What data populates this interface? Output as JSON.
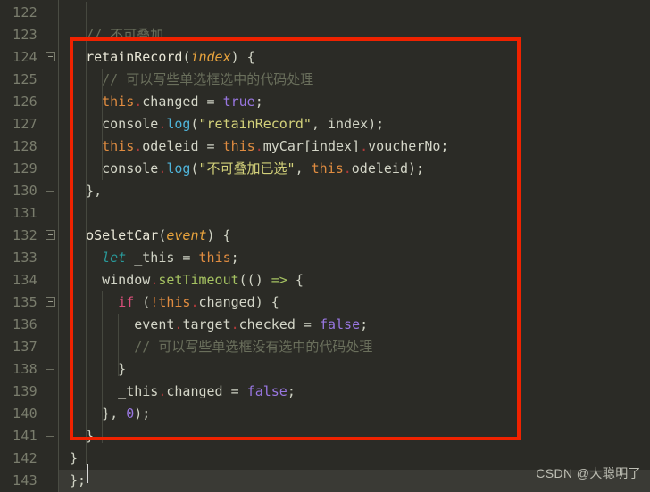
{
  "editor": {
    "background_color": "#2b2b26",
    "gutter_color": "#2b2b26",
    "line_number_color": "#7a7d6d",
    "current_line_color": "#3a3a35",
    "first_line_number": 122,
    "last_line_number": 143,
    "line_numbers": [
      "122",
      "123",
      "124",
      "125",
      "126",
      "127",
      "128",
      "129",
      "130",
      "131",
      "132",
      "133",
      "134",
      "135",
      "136",
      "137",
      "138",
      "139",
      "140",
      "141",
      "142",
      "143"
    ],
    "fold_lines": [
      "124",
      "132",
      "135"
    ],
    "dash_lines": [
      "130",
      "138",
      "141"
    ],
    "caret_line": "143"
  },
  "annotation": {
    "color": "#ef2200",
    "shape": "rectangle",
    "covers_lines_from": "124",
    "covers_lines_to": "141"
  },
  "watermark": {
    "text": "CSDN @大聪明了"
  },
  "code": {
    "lines": [
      {
        "n": "122",
        "text": ""
      },
      {
        "n": "123",
        "text": "  // 不可叠加"
      },
      {
        "n": "124",
        "text": "  retainRecord(index) {"
      },
      {
        "n": "125",
        "text": "    // 可以写些单选框选中的代码处理"
      },
      {
        "n": "126",
        "text": "    this.changed = true;"
      },
      {
        "n": "127",
        "text": "    console.log(\"retainRecord\", index);"
      },
      {
        "n": "128",
        "text": "    this.odeleid = this.myCar[index].voucherNo;"
      },
      {
        "n": "129",
        "text": "    console.log(\"不可叠加已选\", this.odeleid);"
      },
      {
        "n": "130",
        "text": "  },"
      },
      {
        "n": "131",
        "text": ""
      },
      {
        "n": "132",
        "text": "  oSeletCar(event) {"
      },
      {
        "n": "133",
        "text": "    let _this = this;"
      },
      {
        "n": "134",
        "text": "    window.setTimeout(() => {"
      },
      {
        "n": "135",
        "text": "      if (!this.changed) {"
      },
      {
        "n": "136",
        "text": "        event.target.checked = false;"
      },
      {
        "n": "137",
        "text": "        // 可以写些单选框没有选中的代码处理"
      },
      {
        "n": "138",
        "text": "      }"
      },
      {
        "n": "139",
        "text": "      _this.changed = false;"
      },
      {
        "n": "140",
        "text": "    }, 0);"
      },
      {
        "n": "141",
        "text": "  }"
      },
      {
        "n": "142",
        "text": "}"
      },
      {
        "n": "143",
        "text": "};"
      }
    ],
    "comment_123": "// 不可叠加",
    "comment_125": "// 可以写些单选框选中的代码处理",
    "comment_137": "// 可以写些单选框没有选中的代码处理",
    "string_127": "\"retainRecord\"",
    "string_129": "\"不可叠加已选\""
  },
  "tokens": {
    "l123": [
      {
        "t": "  ",
        "c": "t-plain"
      },
      {
        "t": "// 不可叠加",
        "c": "t-cmt"
      }
    ],
    "l124": [
      {
        "t": "  ",
        "c": "t-plain"
      },
      {
        "t": "retainRecord",
        "c": "t-fn"
      },
      {
        "t": "(",
        "c": "t-punct"
      },
      {
        "t": "index",
        "c": "t-param"
      },
      {
        "t": ") {",
        "c": "t-punct"
      }
    ],
    "l125": [
      {
        "t": "    ",
        "c": "t-plain"
      },
      {
        "t": "// 可以写些单选框选中的代码处理",
        "c": "t-cmt"
      }
    ],
    "l126": [
      {
        "t": "    ",
        "c": "t-plain"
      },
      {
        "t": "this",
        "c": "t-this"
      },
      {
        "t": ".",
        "c": "t-dot"
      },
      {
        "t": "changed",
        "c": "t-prop"
      },
      {
        "t": " = ",
        "c": "t-punct"
      },
      {
        "t": "true",
        "c": "t-const"
      },
      {
        "t": ";",
        "c": "t-punct"
      }
    ],
    "l127": [
      {
        "t": "    ",
        "c": "t-plain"
      },
      {
        "t": "console",
        "c": "t-prop"
      },
      {
        "t": ".",
        "c": "t-dot"
      },
      {
        "t": "log",
        "c": "t-method"
      },
      {
        "t": "(",
        "c": "t-punct"
      },
      {
        "t": "\"retainRecord\"",
        "c": "t-str"
      },
      {
        "t": ", index);",
        "c": "t-punct"
      }
    ],
    "l128": [
      {
        "t": "    ",
        "c": "t-plain"
      },
      {
        "t": "this",
        "c": "t-this"
      },
      {
        "t": ".",
        "c": "t-dot"
      },
      {
        "t": "odeleid",
        "c": "t-prop"
      },
      {
        "t": " = ",
        "c": "t-punct"
      },
      {
        "t": "this",
        "c": "t-this"
      },
      {
        "t": ".",
        "c": "t-dot"
      },
      {
        "t": "myCar[index]",
        "c": "t-prop"
      },
      {
        "t": ".",
        "c": "t-dot"
      },
      {
        "t": "voucherNo;",
        "c": "t-prop"
      }
    ],
    "l129": [
      {
        "t": "    ",
        "c": "t-plain"
      },
      {
        "t": "console",
        "c": "t-prop"
      },
      {
        "t": ".",
        "c": "t-dot"
      },
      {
        "t": "log",
        "c": "t-method"
      },
      {
        "t": "(",
        "c": "t-punct"
      },
      {
        "t": "\"不可叠加已选\"",
        "c": "t-str"
      },
      {
        "t": ", ",
        "c": "t-punct"
      },
      {
        "t": "this",
        "c": "t-this"
      },
      {
        "t": ".",
        "c": "t-dot"
      },
      {
        "t": "odeleid);",
        "c": "t-prop"
      }
    ],
    "l130": [
      {
        "t": "  },",
        "c": "t-punct"
      }
    ],
    "l132": [
      {
        "t": "  ",
        "c": "t-plain"
      },
      {
        "t": "oSeletCar",
        "c": "t-fn"
      },
      {
        "t": "(",
        "c": "t-punct"
      },
      {
        "t": "event",
        "c": "t-param"
      },
      {
        "t": ") {",
        "c": "t-punct"
      }
    ],
    "l133": [
      {
        "t": "    ",
        "c": "t-plain"
      },
      {
        "t": "let",
        "c": "t-kw2"
      },
      {
        "t": " _this = ",
        "c": "t-punct"
      },
      {
        "t": "this",
        "c": "t-this"
      },
      {
        "t": ";",
        "c": "t-punct"
      }
    ],
    "l134": [
      {
        "t": "    ",
        "c": "t-plain"
      },
      {
        "t": "window",
        "c": "t-prop"
      },
      {
        "t": ".",
        "c": "t-dot"
      },
      {
        "t": "setTimeout",
        "c": "t-method2"
      },
      {
        "t": "(() ",
        "c": "t-punct"
      },
      {
        "t": "=>",
        "c": "t-arrow"
      },
      {
        "t": " {",
        "c": "t-punct"
      }
    ],
    "l135": [
      {
        "t": "      ",
        "c": "t-plain"
      },
      {
        "t": "if",
        "c": "t-if"
      },
      {
        "t": " (",
        "c": "t-punct"
      },
      {
        "t": "!",
        "c": "t-bang"
      },
      {
        "t": "this",
        "c": "t-this"
      },
      {
        "t": ".",
        "c": "t-dot"
      },
      {
        "t": "changed",
        "c": "t-prop"
      },
      {
        "t": ") {",
        "c": "t-punct"
      }
    ],
    "l136": [
      {
        "t": "        event",
        "c": "t-prop"
      },
      {
        "t": ".",
        "c": "t-dot"
      },
      {
        "t": "target",
        "c": "t-prop"
      },
      {
        "t": ".",
        "c": "t-dot"
      },
      {
        "t": "checked",
        "c": "t-prop"
      },
      {
        "t": " = ",
        "c": "t-punct"
      },
      {
        "t": "false",
        "c": "t-const"
      },
      {
        "t": ";",
        "c": "t-punct"
      }
    ],
    "l137": [
      {
        "t": "        ",
        "c": "t-plain"
      },
      {
        "t": "// 可以写些单选框没有选中的代码处理",
        "c": "t-cmt"
      }
    ],
    "l138": [
      {
        "t": "      }",
        "c": "t-punct"
      }
    ],
    "l139": [
      {
        "t": "      _this",
        "c": "t-prop"
      },
      {
        "t": ".",
        "c": "t-dot"
      },
      {
        "t": "changed",
        "c": "t-prop"
      },
      {
        "t": " = ",
        "c": "t-punct"
      },
      {
        "t": "false",
        "c": "t-const"
      },
      {
        "t": ";",
        "c": "t-punct"
      }
    ],
    "l140": [
      {
        "t": "    }, ",
        "c": "t-punct"
      },
      {
        "t": "0",
        "c": "t-const"
      },
      {
        "t": ");",
        "c": "t-punct"
      }
    ],
    "l141": [
      {
        "t": "  }",
        "c": "t-punct"
      }
    ],
    "l142": [
      {
        "t": "}",
        "c": "t-punct"
      }
    ],
    "l143": [
      {
        "t": "};",
        "c": "t-punct"
      }
    ]
  }
}
